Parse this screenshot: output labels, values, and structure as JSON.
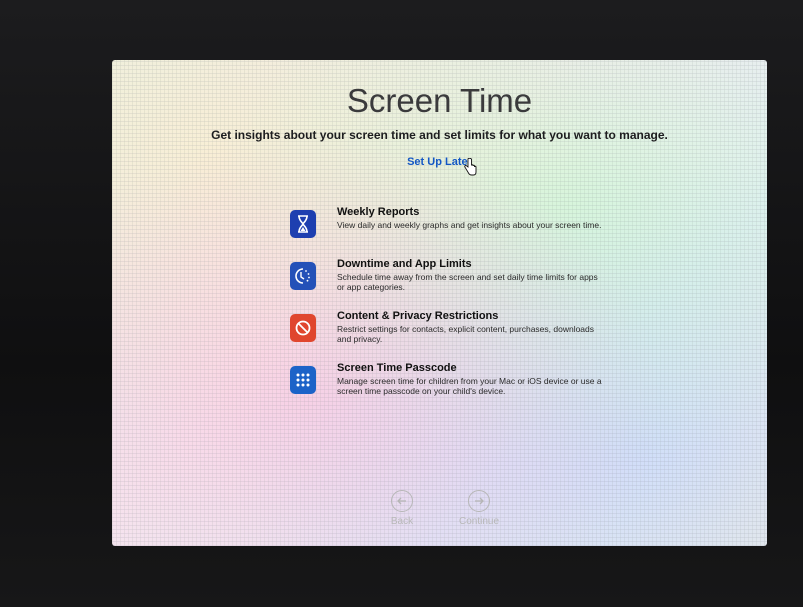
{
  "screen": {
    "title": "Screen Time",
    "subtitle": "Get insights about your screen time and set limits for what you want to manage.",
    "setup_later": "Set Up Later"
  },
  "features": [
    {
      "title": "Weekly Reports",
      "description": "View daily and weekly graphs and get insights about your screen time.",
      "icon": "hourglass-icon",
      "color": "#1e3fb0"
    },
    {
      "title": "Downtime and App Limits",
      "description": "Schedule time away from the screen and set daily time limits for apps or app categories.",
      "icon": "downtime-icon",
      "color": "#2451b8"
    },
    {
      "title": "Content & Privacy Restrictions",
      "description": "Restrict settings for contacts, explicit content, purchases, downloads and privacy.",
      "icon": "restriction-icon",
      "color": "#e0462e"
    },
    {
      "title": "Screen Time Passcode",
      "description": "Manage screen time for children from your Mac or iOS device or use a screen time passcode on your child's device.",
      "icon": "keypad-icon",
      "color": "#1c63c8"
    }
  ],
  "navigation": {
    "back_label": "Back",
    "continue_label": "Continue"
  }
}
